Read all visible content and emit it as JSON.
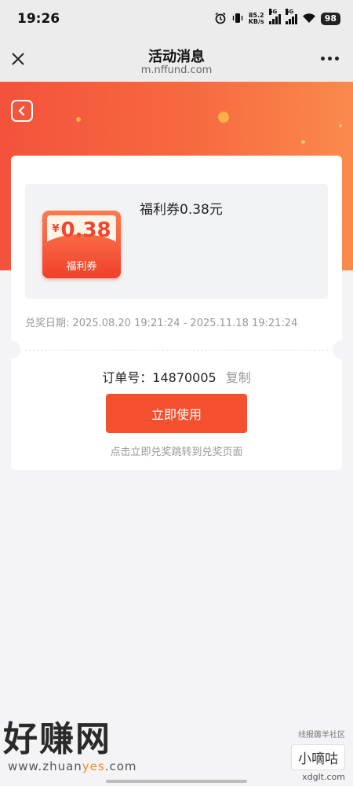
{
  "status_bar": {
    "time": "19:26",
    "net_speed_value": "85.2",
    "net_speed_unit": "KB/s",
    "sim1_label": "5G",
    "sim2_label": "5G",
    "battery": "98",
    "icons": [
      "alarm-icon",
      "vibrate-icon",
      "signal-icon",
      "wifi-icon",
      "battery-icon"
    ]
  },
  "title_bar": {
    "title": "活动消息",
    "subtitle": "m.nffund.com",
    "icons": [
      "close-icon",
      "more-icon"
    ]
  },
  "coupon": {
    "title": "福利券0.38元",
    "currency": "¥",
    "amount": "0.38",
    "badge_label": "福利券",
    "date_range": "兑奖日期: 2025.08.20 19:21:24 - 2025.11.18 19:21:24"
  },
  "order": {
    "label": "订单号：",
    "number": "14870005",
    "copy_label": "复制"
  },
  "actions": {
    "use_button": "立即使用",
    "hint": "点击立即兑奖跳转到兑奖页面"
  },
  "watermark": {
    "left_big": "好赚网",
    "left_url_a": "www.zhuan",
    "left_url_b": "yes",
    "left_url_c": ".com",
    "right_small": "线报薅羊社区",
    "right_box": "小嘀咕",
    "right_url": "xdglt.com"
  },
  "colors": {
    "accent": "#f4502f",
    "hero_start": "#f4523b",
    "hero_end": "#fa8a4c"
  }
}
